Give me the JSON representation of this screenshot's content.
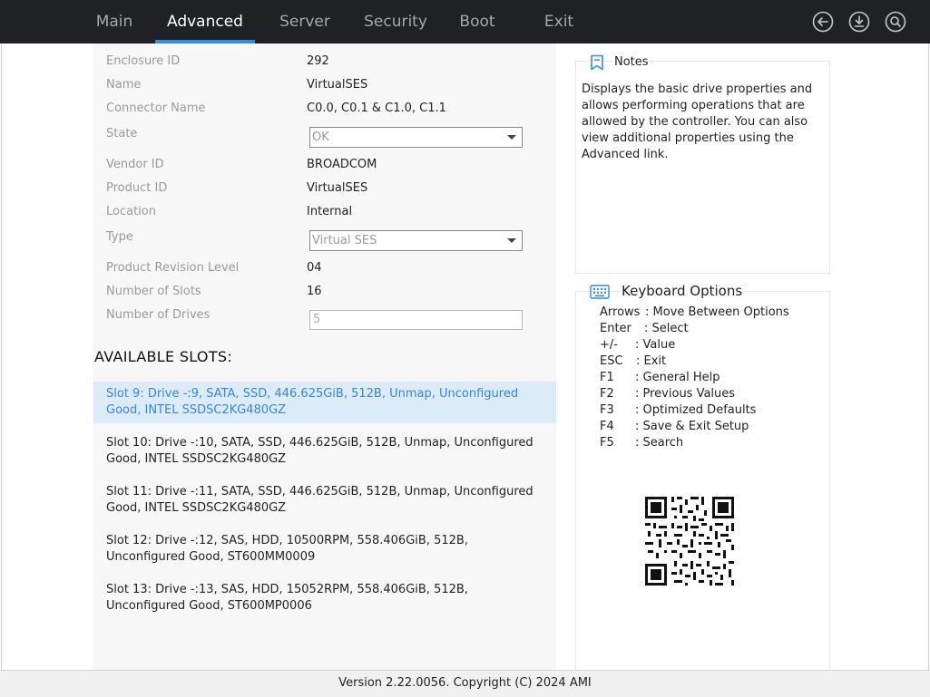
{
  "nav": {
    "tabs": [
      {
        "label": "Main"
      },
      {
        "label": "Advanced"
      },
      {
        "label": "Server"
      },
      {
        "label": "Security"
      },
      {
        "label": "Boot"
      },
      {
        "label": "Exit"
      }
    ],
    "active_tab": "Advanced",
    "icons": [
      "back-arrow-icon",
      "download-icon",
      "search-icon"
    ],
    "accent_color": "#2f8ee6"
  },
  "properties": [
    {
      "label": "Enclosure ID",
      "value": "292"
    },
    {
      "label": "Name",
      "value": "VirtualSES"
    },
    {
      "label": "Connector Name",
      "value": "C0.0, C0.1 & C1.0, C1.1"
    },
    {
      "label": "State",
      "value": "OK"
    },
    {
      "label": "Vendor ID",
      "value": "BROADCOM"
    },
    {
      "label": "Product ID",
      "value": "VirtualSES"
    },
    {
      "label": "Location",
      "value": "Internal"
    },
    {
      "label": "Type",
      "value": "Virtual SES"
    },
    {
      "label": "Product Revision Level",
      "value": "04"
    },
    {
      "label": "Number of Slots",
      "value": "16"
    },
    {
      "label": "Number of Drives",
      "value": "5"
    }
  ],
  "slots_heading": "AVAILABLE SLOTS:",
  "slots": [
    {
      "text": "Slot 9: Drive -:9, SATA, SSD, 446.625GiB, 512B, Unmap, Unconfigured Good, INTEL SSDSC2KG480GZ"
    },
    {
      "text": "Slot 10: Drive -:10, SATA, SSD, 446.625GiB, 512B, Unmap, Unconfigured Good, INTEL SSDSC2KG480GZ"
    },
    {
      "text": "Slot 11: Drive -:11, SATA, SSD, 446.625GiB, 512B, Unmap, Unconfigured Good, INTEL SSDSC2KG480GZ"
    },
    {
      "text": "Slot 12: Drive -:12, SAS, HDD, 10500RPM, 558.406GiB, 512B, Unconfigured Good, ST600MM0009"
    },
    {
      "text": "Slot 13: Drive -:13, SAS, HDD, 15052RPM, 558.406GiB, 512B, Unconfigured Good, ST600MP0006"
    }
  ],
  "selected_slot": 0,
  "notes": {
    "title": "Notes",
    "text": "Displays the basic drive properties and allows performing operations that are allowed by the controller. You can also view additional properties using the Advanced link."
  },
  "keyboard": {
    "title": "Keyboard Options",
    "options": [
      {
        "key": "Arrows",
        "desc": ": Move Between Options"
      },
      {
        "key": "Enter",
        "desc": ": Select"
      },
      {
        "key": "+/-",
        "desc": ": Value"
      },
      {
        "key": "ESC",
        "desc": ": Exit"
      },
      {
        "key": "F1",
        "desc": ": General Help"
      },
      {
        "key": "F2",
        "desc": ": Previous Values"
      },
      {
        "key": "F3",
        "desc": ": Optimized Defaults"
      },
      {
        "key": "F4",
        "desc": ": Save & Exit Setup"
      },
      {
        "key": "F5",
        "desc": ": Search"
      }
    ]
  },
  "footer": {
    "text": "Version 2.22.0056. Copyright (C) 2024 AMI"
  }
}
